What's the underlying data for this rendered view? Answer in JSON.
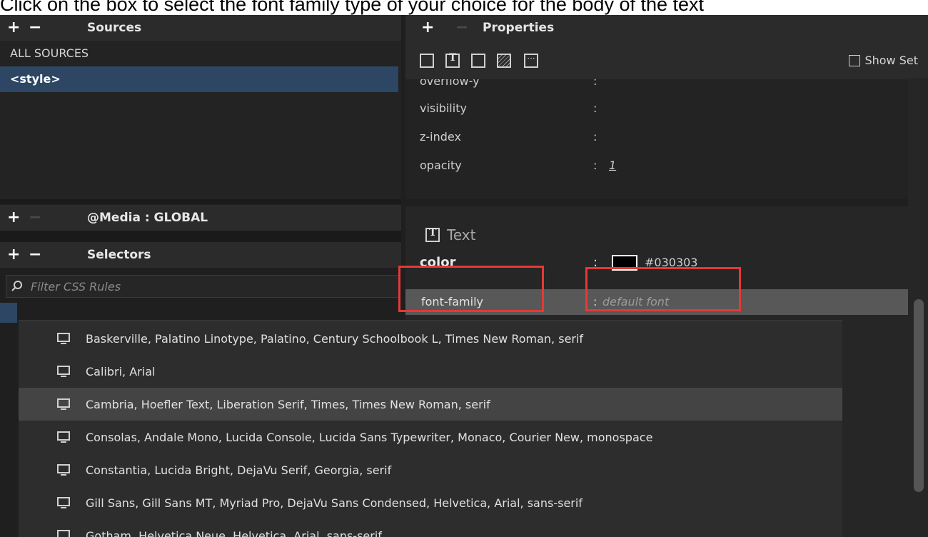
{
  "caption": "Click on the box to select the font family type of your choice for the body of the text",
  "sources_panel": {
    "title": "Sources",
    "items": [
      "ALL SOURCES",
      "<style>"
    ]
  },
  "media_panel": {
    "title": "@Media :  GLOBAL"
  },
  "selectors_panel": {
    "title": "Selectors",
    "filter_placeholder": "Filter CSS Rules"
  },
  "properties_panel": {
    "title": "Properties",
    "show_set_label": "Show Set",
    "layout_props": [
      {
        "name": "overflow-y",
        "value": ""
      },
      {
        "name": "visibility",
        "value": ""
      },
      {
        "name": "z-index",
        "value": ""
      },
      {
        "name": "opacity",
        "value": "1"
      }
    ],
    "text_section": {
      "title": "Text",
      "color_label": "color",
      "color_value": "#030303",
      "font_family_label": "font-family",
      "font_family_placeholder": "default font"
    }
  },
  "font_dropdown": [
    "Baskerville, Palatino Linotype, Palatino, Century Schoolbook L, Times New Roman, serif",
    "Calibri, Arial",
    "Cambria, Hoefler Text, Liberation Serif, Times, Times New Roman, serif",
    "Consolas, Andale Mono, Lucida Console, Lucida Sans Typewriter, Monaco, Courier New, monospace",
    "Constantia, Lucida Bright, DejaVu Serif, Georgia, serif",
    "Gill Sans, Gill Sans MT, Myriad Pro, DejaVu Sans Condensed, Helvetica, Arial, sans-serif",
    "Gotham, Helvetica Neue, Helvetica, Arial, sans-serif"
  ],
  "colors": {
    "accent": "#2c4663",
    "highlight": "#e53935",
    "panel_bg": "#2b2b2b"
  }
}
